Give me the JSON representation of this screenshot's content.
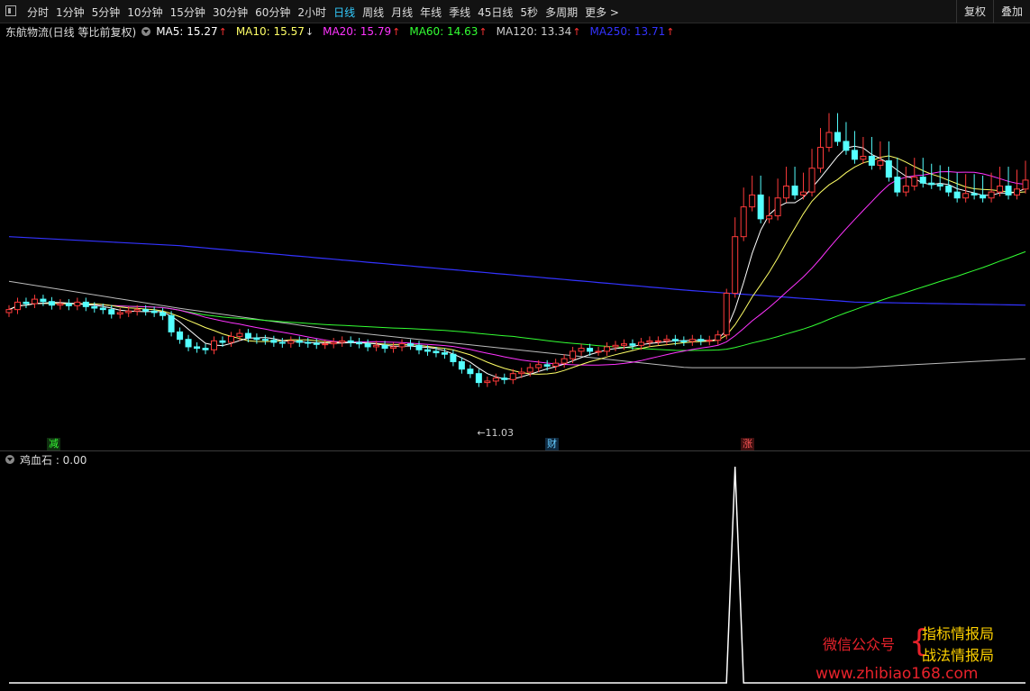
{
  "toolbar": {
    "periods": [
      "分时",
      "1分钟",
      "5分钟",
      "10分钟",
      "15分钟",
      "30分钟",
      "60分钟",
      "2小时",
      "日线",
      "周线",
      "月线",
      "年线",
      "季线",
      "45日线",
      "5秒",
      "多周期",
      "更多 >"
    ],
    "active_period": "日线",
    "right_buttons": [
      "复权",
      "叠加"
    ]
  },
  "chart_title": "东航物流(日线 等比前复权)",
  "ma_legend": [
    {
      "label": "MA5: 15.27",
      "color": "#ffffff",
      "trend": "up"
    },
    {
      "label": "MA10: 15.57",
      "color": "#ffff66",
      "trend": "down"
    },
    {
      "label": "MA20: 15.79",
      "color": "#ff33ff",
      "trend": "up"
    },
    {
      "label": "MA60: 14.63",
      "color": "#33ff33",
      "trend": "up"
    },
    {
      "label": "MA120: 13.34",
      "color": "#cccccc",
      "trend": "up"
    },
    {
      "label": "MA250: 13.71",
      "color": "#3333ff",
      "trend": "up"
    }
  ],
  "low_label": "←11.03",
  "markers": [
    {
      "text": "减",
      "color": "#33ff33",
      "bg": "#103010"
    },
    {
      "text": "财",
      "color": "#66ccff",
      "bg": "#102a40"
    },
    {
      "text": "涨",
      "color": "#ff5555",
      "bg": "#401010"
    }
  ],
  "indicator": {
    "label": "鸡血石 : 0.00"
  },
  "watermark": {
    "left": "微信公众号",
    "right1": "指标情报局",
    "right2": "战法情报局",
    "url": "www.zhibiao168.com"
  },
  "colors": {
    "up": "#ff3b3b",
    "down": "#54ffff",
    "ind_line": "#ffffff"
  },
  "chart_data": {
    "type": "candlestick",
    "count": 120,
    "closes": [
      15.35,
      15.6,
      15.55,
      15.7,
      15.62,
      15.5,
      15.55,
      15.48,
      15.6,
      15.45,
      15.4,
      15.35,
      15.2,
      15.25,
      15.3,
      15.35,
      15.3,
      15.25,
      15.15,
      14.6,
      14.35,
      14.1,
      14.05,
      14.0,
      14.3,
      14.25,
      14.45,
      14.55,
      14.4,
      14.35,
      14.32,
      14.25,
      14.22,
      14.3,
      14.25,
      14.22,
      14.18,
      14.2,
      14.25,
      14.3,
      14.25,
      14.2,
      14.1,
      14.15,
      14.05,
      14.1,
      14.2,
      14.15,
      14.0,
      13.95,
      13.9,
      13.85,
      13.6,
      13.35,
      13.2,
      12.9,
      12.95,
      13.05,
      13.0,
      13.2,
      13.25,
      13.4,
      13.5,
      13.45,
      13.55,
      13.7,
      13.95,
      14.05,
      13.95,
      13.95,
      14.1,
      14.15,
      14.2,
      14.15,
      14.25,
      14.3,
      14.3,
      14.35,
      14.3,
      14.28,
      14.35,
      14.3,
      14.32,
      14.5,
      15.9,
      17.8,
      18.8,
      19.2,
      18.4,
      18.5,
      19.1,
      19.5,
      19.2,
      19.3,
      20.1,
      20.8,
      21.3,
      21.0,
      20.7,
      20.4,
      20.5,
      20.2,
      20.35,
      19.8,
      19.3,
      19.5,
      19.8,
      19.6,
      19.55,
      19.5,
      19.3,
      19.1,
      19.25,
      19.2,
      19.1,
      19.3,
      19.5,
      19.2,
      19.4,
      19.7
    ],
    "y_range": [
      10.8,
      22.3
    ],
    "ma_trends": {
      "MA120": [
        16.3,
        15.4,
        14.6,
        14.0,
        13.4,
        13.4,
        13.7
      ],
      "MA250": [
        17.8,
        17.5,
        17.0,
        16.5,
        16.0,
        15.6,
        15.5
      ]
    },
    "indicator_values": {
      "spike_index": 85,
      "spike_value": 1.0,
      "baseline": 0.0
    }
  }
}
